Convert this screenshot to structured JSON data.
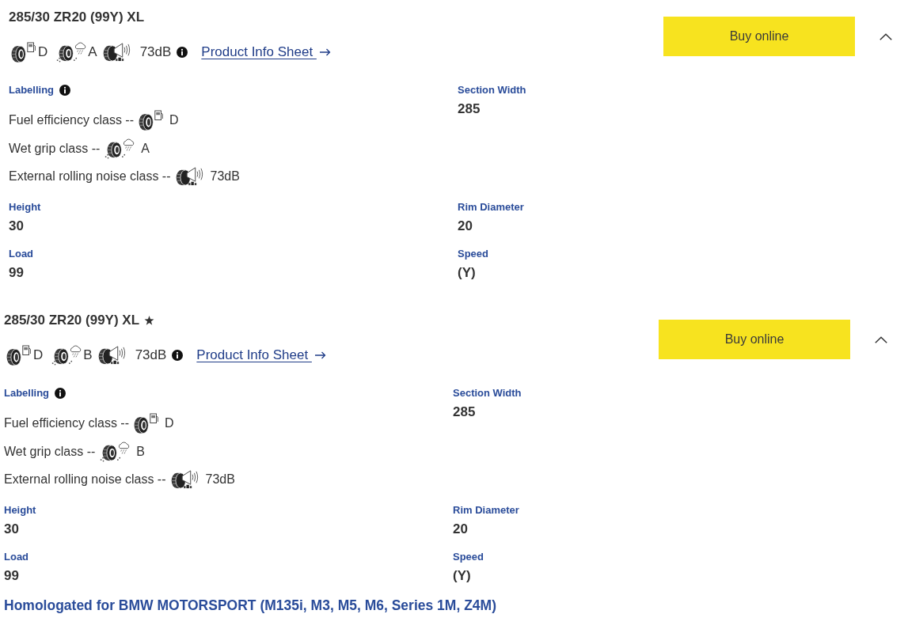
{
  "products": [
    {
      "title": "285/30 ZR20 (99Y) XL",
      "starred": false,
      "expanded": true,
      "buy_button": "Buy online",
      "ratings": [
        {
          "kind": "fuel",
          "value": "D"
        },
        {
          "kind": "wet_grip",
          "value": "A"
        },
        {
          "kind": "noise",
          "value": "73dB"
        }
      ],
      "info_link": "Product Info Sheet",
      "details": [
        {
          "kind": "labelling",
          "label": "Labelling",
          "rows": [
            {
              "kind": "fuel",
              "label": "Fuel efficiency class --",
              "value": "D"
            },
            {
              "kind": "wet_grip",
              "label": "Wet grip class --",
              "value": "A"
            },
            {
              "kind": "noise",
              "label": "External rolling noise class --",
              "value": "73dB"
            }
          ]
        },
        {
          "kind": "spec",
          "label": "Section Width",
          "value": "285"
        },
        {
          "kind": "spec",
          "label": "Height",
          "value": "30"
        },
        {
          "kind": "spec",
          "label": "Rim Diameter",
          "value": "20"
        },
        {
          "kind": "spec",
          "label": "Load",
          "value": "99"
        },
        {
          "kind": "spec",
          "label": "Speed",
          "value": "(Y)"
        }
      ]
    },
    {
      "title": "285/30 ZR20 (99Y) XL",
      "starred": true,
      "expanded": true,
      "buy_button": "Buy online",
      "ratings": [
        {
          "kind": "fuel",
          "value": "D"
        },
        {
          "kind": "wet_grip",
          "value": "B"
        },
        {
          "kind": "noise",
          "value": "73dB"
        }
      ],
      "info_link": "Product Info Sheet",
      "details": [
        {
          "kind": "labelling",
          "label": "Labelling",
          "rows": [
            {
              "kind": "fuel",
              "label": "Fuel efficiency class --",
              "value": "D"
            },
            {
              "kind": "wet_grip",
              "label": "Wet grip class --",
              "value": "B"
            },
            {
              "kind": "noise",
              "label": "External rolling noise class --",
              "value": "73dB"
            }
          ]
        },
        {
          "kind": "spec",
          "label": "Section Width",
          "value": "285"
        },
        {
          "kind": "spec",
          "label": "Height",
          "value": "30"
        },
        {
          "kind": "spec",
          "label": "Rim Diameter",
          "value": "20"
        },
        {
          "kind": "spec",
          "label": "Load",
          "value": "99"
        },
        {
          "kind": "spec",
          "label": "Speed",
          "value": "(Y)"
        }
      ],
      "note": "Homologated for BMW MOTORSPORT (M135i, M3, M5, M6, Series 1M, Z4M)"
    }
  ]
}
